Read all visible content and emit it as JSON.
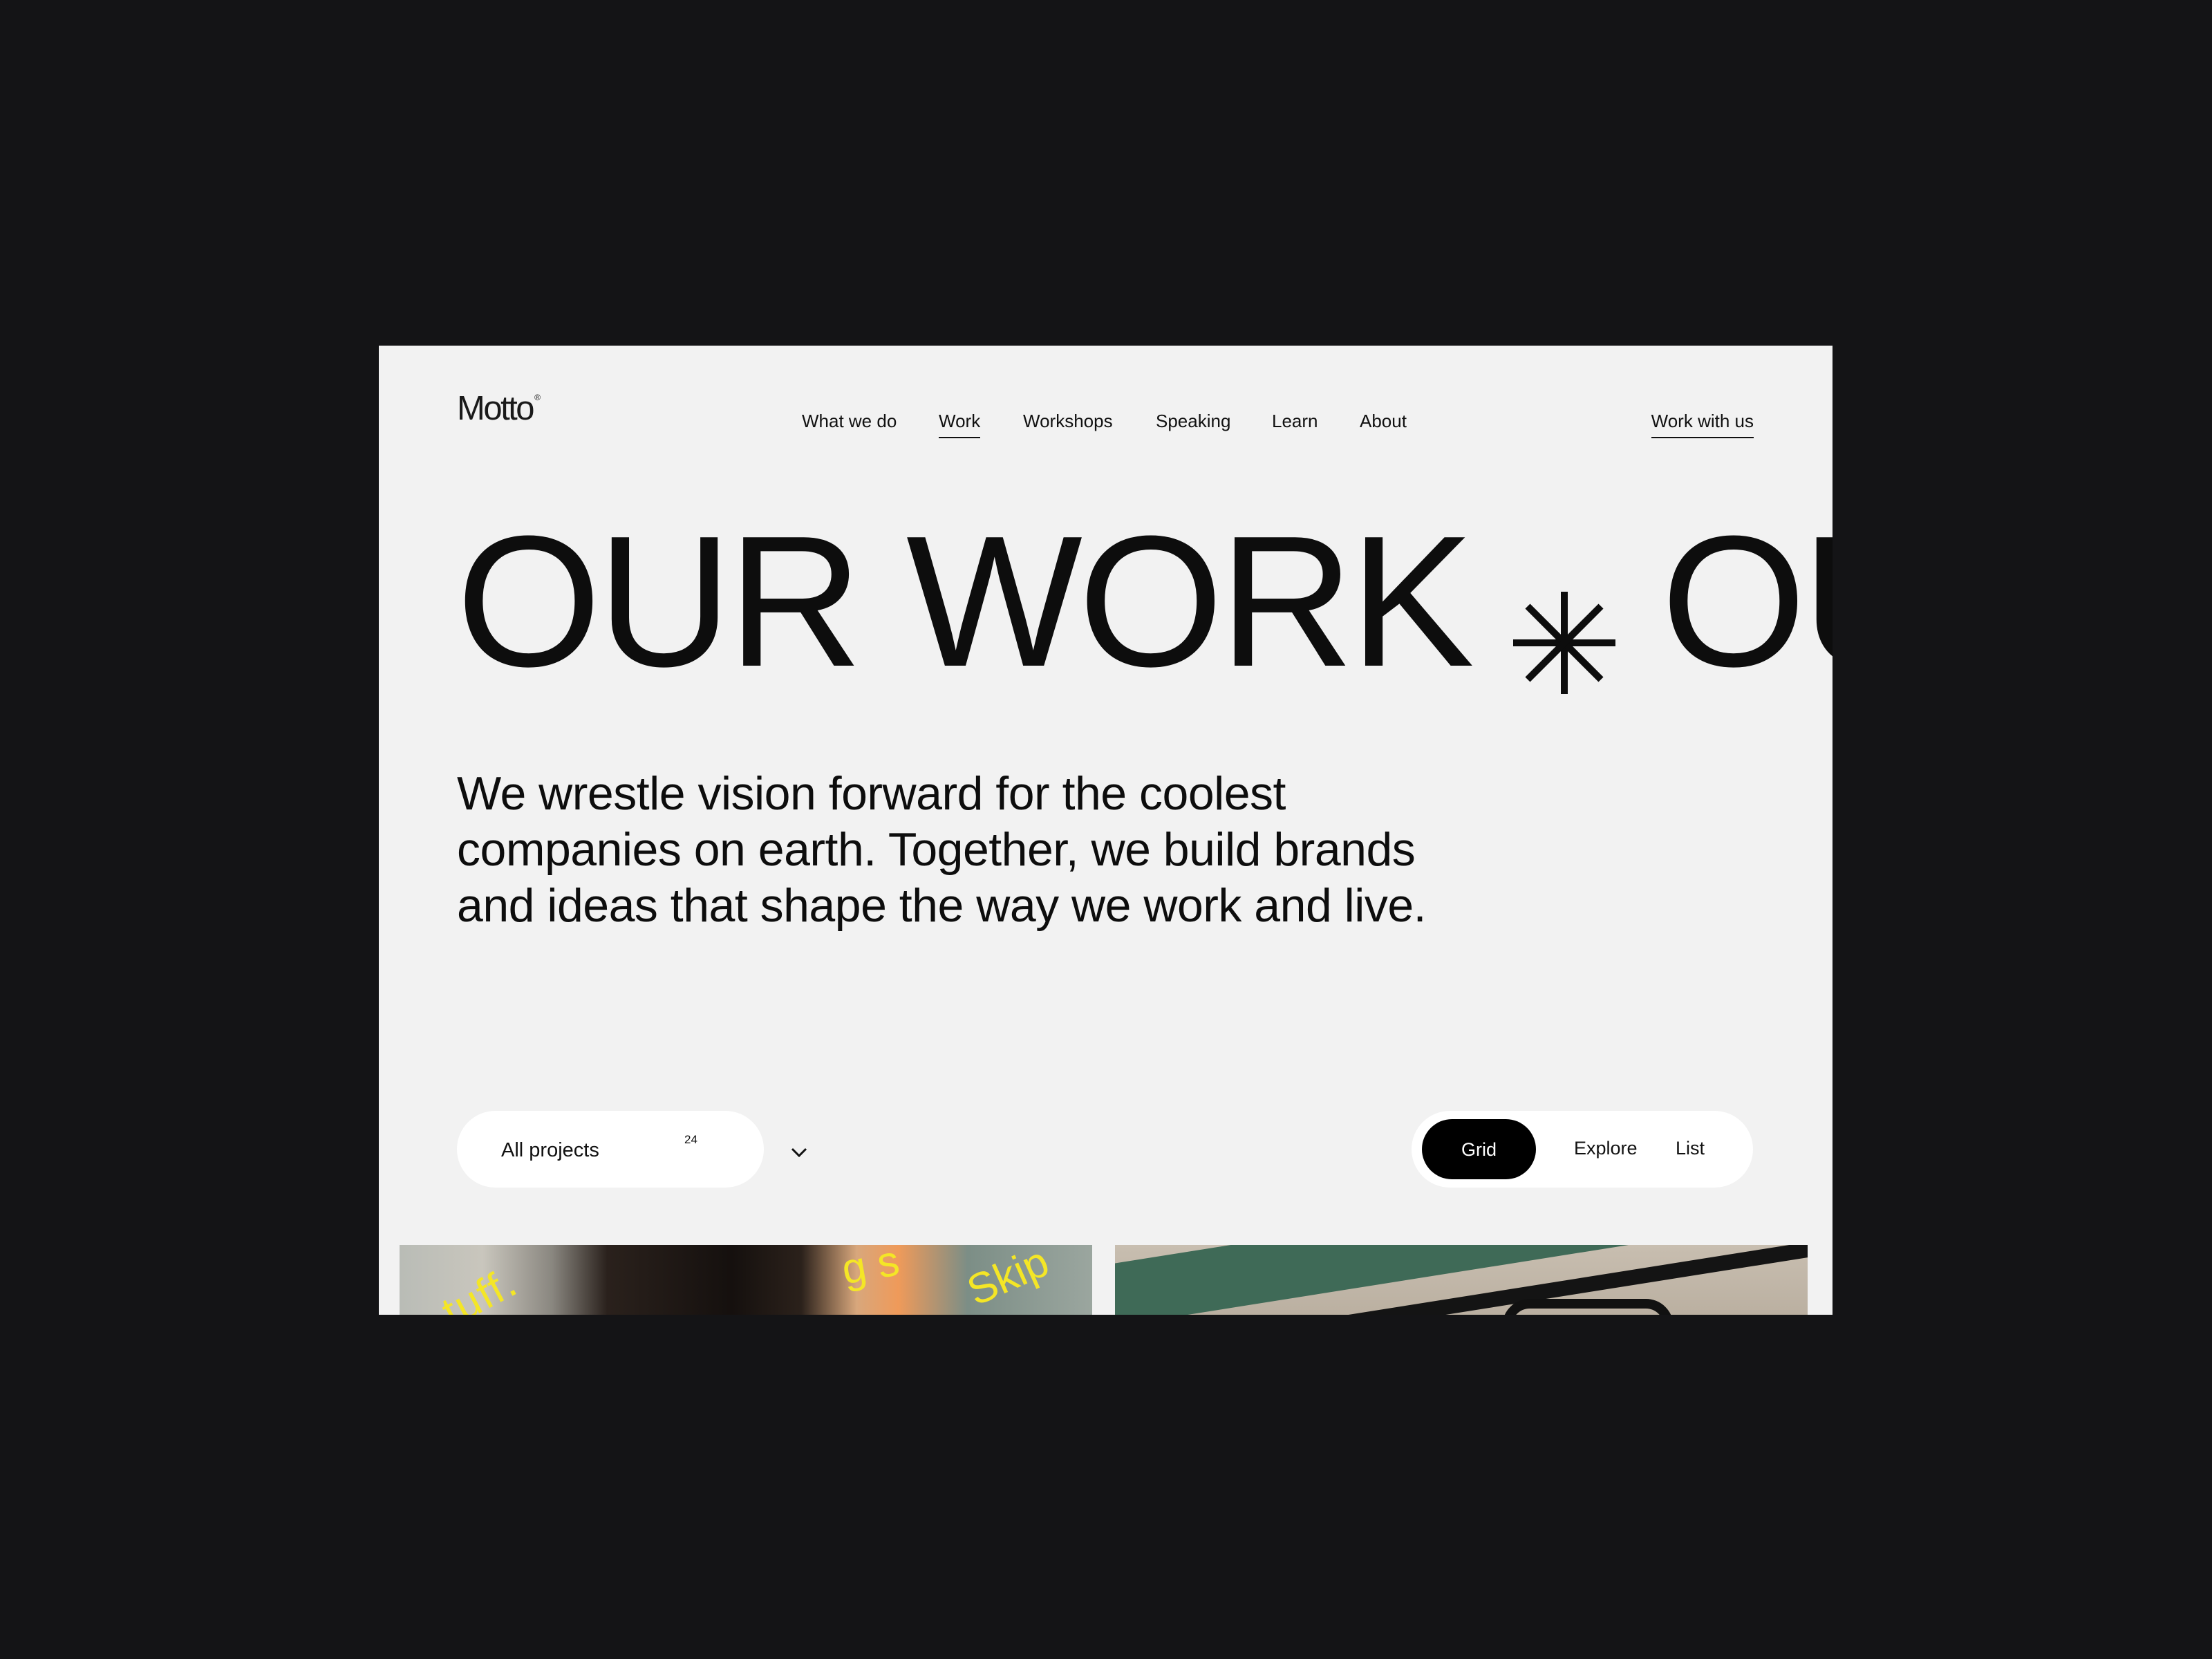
{
  "brand": {
    "name": "Motto",
    "registered_mark": "®"
  },
  "nav": {
    "items": [
      {
        "label": "What we do"
      },
      {
        "label": "Work",
        "active": true
      },
      {
        "label": "Workshops"
      },
      {
        "label": "Speaking"
      },
      {
        "label": "Learn"
      },
      {
        "label": "About"
      }
    ],
    "cta_label": "Work with us"
  },
  "hero": {
    "title_1": "OUR WORK",
    "title_2": "OUR",
    "separator_icon": "asterisk-icon"
  },
  "intro": {
    "text": "We wrestle vision forward for the coolest companies on earth. Together, we build brands and ideas that shape the way we work and live."
  },
  "filter": {
    "label": "All projects",
    "count": "24",
    "icon": "chevron-down-icon"
  },
  "view_toggle": {
    "options": [
      {
        "label": "Grid",
        "selected": true
      },
      {
        "label": "Explore"
      },
      {
        "label": "List"
      }
    ]
  },
  "projects": {
    "card_1": {
      "overlay_text_left": "tuff.",
      "overlay_text_mid": "g s",
      "overlay_text_right": "Skip"
    },
    "card_2": {}
  },
  "colors": {
    "page_background": "#141416",
    "frame_background": "#f2f2f2",
    "text": "#0d0d0d",
    "pill_background": "#ffffff",
    "selected_toggle": "#000000",
    "overlay_yellow": "#f4e626"
  }
}
